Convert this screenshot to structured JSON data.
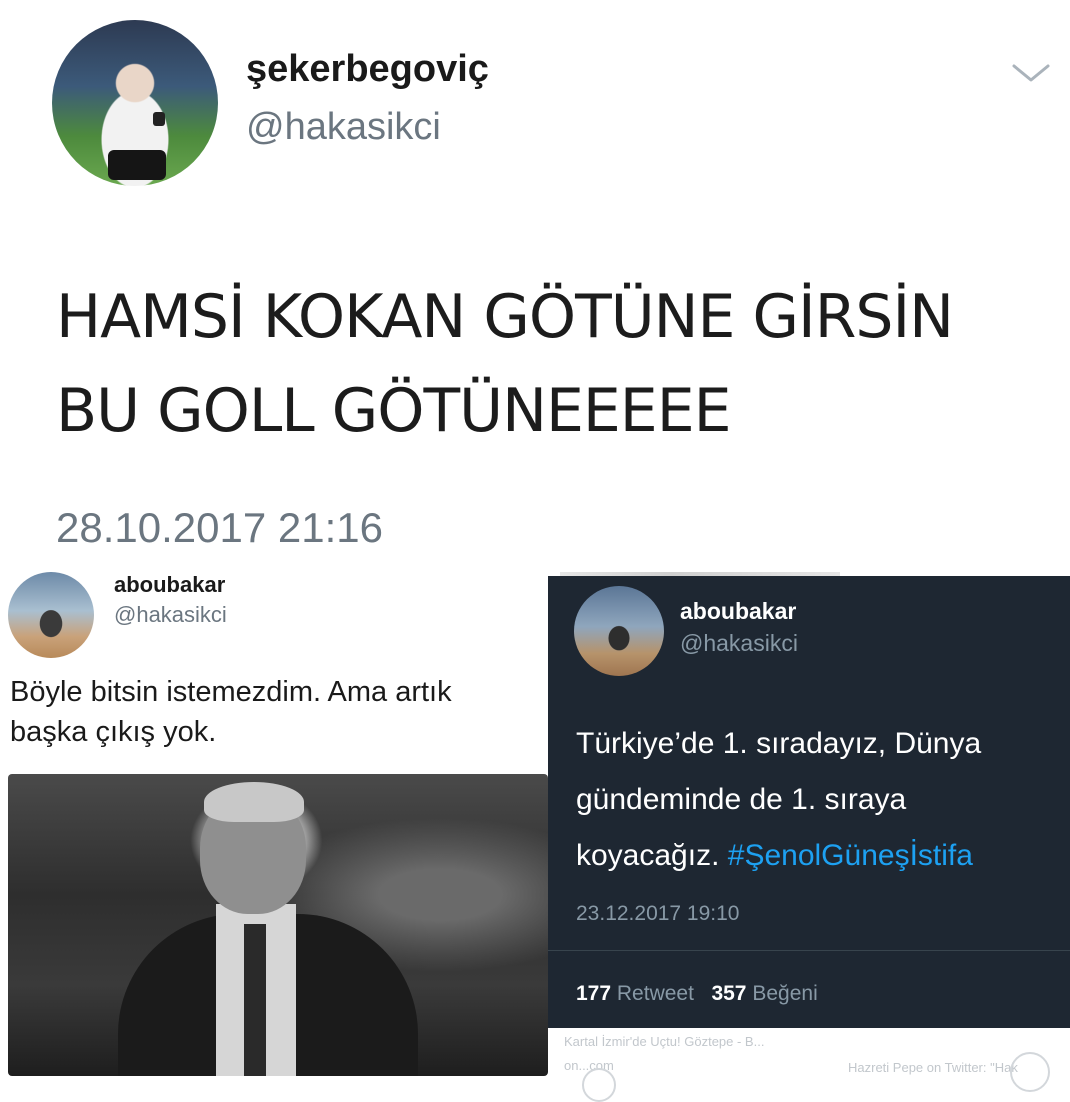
{
  "tweet1": {
    "display_name": "şekerbegoviç",
    "handle": "@hakasikci",
    "text_line1": "HAMSİ KOKAN GÖTÜNE GİRSİN",
    "text_line2": "BU GOLL GÖTÜNEEEEE",
    "timestamp": "28.10.2017 21:16"
  },
  "tweet2": {
    "display_name": "aboubakar",
    "handle": "@hakasikci",
    "text": "Böyle bitsin istemezdim. Ama artık başka çıkış yok."
  },
  "tweet3": {
    "display_name": "aboubakar",
    "handle": "@hakasikci",
    "text_line1": "Türkiye’de 1. sıradayız, Dünya",
    "text_line2": "gündeminde de 1. sıraya",
    "text_line3_prefix": "koyacağız.",
    "hashtag": "#ŞenolGüneşİstifa",
    "timestamp": "23.12.2017 19:10",
    "retweet_count": "177",
    "retweet_label": "Retweet",
    "like_count": "357",
    "like_label": "Beğeni"
  },
  "footer": {
    "link_title": "Kartal İzmir'de Uçtu! Göztepe - B...",
    "link_url": "on...com",
    "right_text": "Hazreti Pepe on Twitter: \"Hak"
  },
  "colors": {
    "dark_bg": "#1e2732",
    "hashtag": "#1da1f2",
    "muted": "#8899a6"
  }
}
